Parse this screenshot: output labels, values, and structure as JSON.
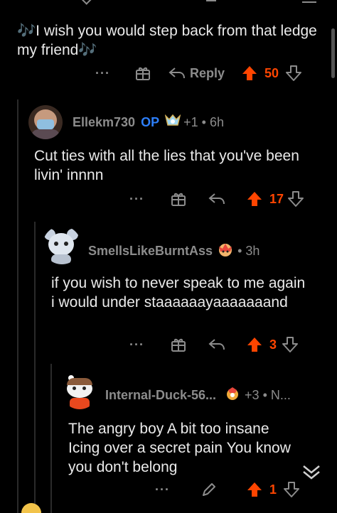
{
  "comment_top": {
    "text": "🎶I wish you would step back from that ledge my friend🎶",
    "upvotes": "50",
    "reply_label": "Reply",
    "more_label": "···"
  },
  "comment_1": {
    "username": "Ellekm730",
    "op_label": "OP",
    "award_count": "+1",
    "age": "6h",
    "text": "Cut ties with all the lies that you've been livin' innnn",
    "upvotes": "17",
    "more_label": "···"
  },
  "comment_2": {
    "username": "SmellsLikeBurntAss",
    "age": "3h",
    "text": "if you wish to never speak to me again i would under staaaaaayaaaaaaand",
    "upvotes": "3",
    "more_label": "···"
  },
  "comment_3": {
    "username": "Internal-Duck-56...",
    "award_count": "+3",
    "age": "N...",
    "text": "The angry boy A bit too insane Icing over a secret pain You know you don't belong",
    "upvotes": "1",
    "more_label": "···"
  },
  "colors": {
    "background": "#000000",
    "upvote_accent": "#ff4500",
    "op_blue": "#2d7ff9",
    "meta_gray": "#8c8c8c"
  }
}
